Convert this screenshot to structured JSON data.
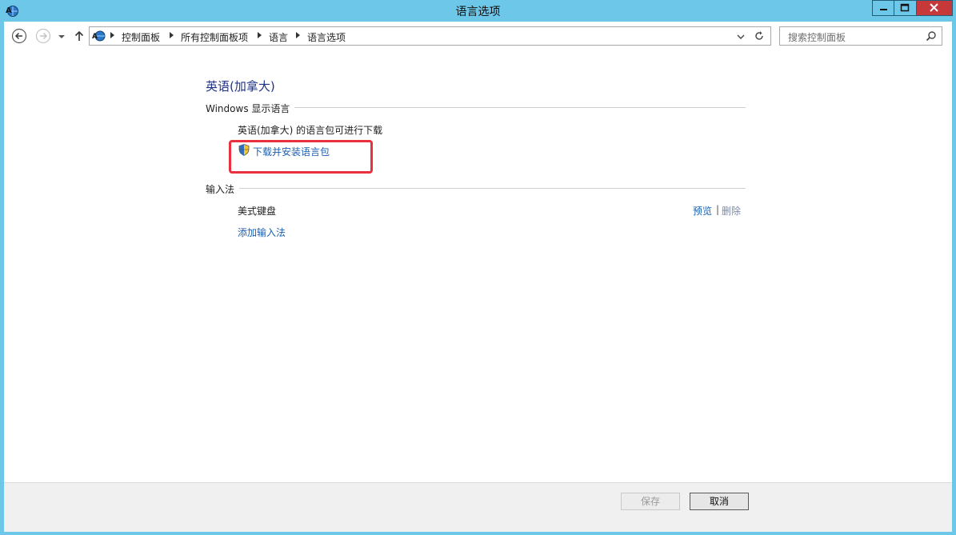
{
  "window": {
    "title": "语言选项",
    "app_icon": "globe-language-icon",
    "controls": [
      "minimize-icon",
      "maximize-icon",
      "close-icon"
    ]
  },
  "nav": {
    "back_icon": "back-arrow-icon",
    "forward_icon": "forward-arrow-icon",
    "recent_icon": "chevron-down-icon",
    "up_icon": "up-arrow-icon",
    "breadcrumb": [
      "控制面板",
      "所有控制面板项",
      "语言",
      "语言选项"
    ],
    "address_dropdown_icon": "chevron-down-icon",
    "refresh_icon": "refresh-icon",
    "search_placeholder": "搜索控制面板",
    "search_icon": "search-icon"
  },
  "main": {
    "language_title": "英语(加拿大)",
    "display_section": {
      "label": "Windows 显示语言",
      "status": "英语(加拿大) 的语言包可进行下载",
      "download_link": "下载并安装语言包",
      "shield_icon": "uac-shield-icon"
    },
    "input_section": {
      "label": "输入法",
      "method_name": "美式键盘",
      "preview_link": "预览",
      "divider": "|",
      "delete_link": "删除",
      "add_link": "添加输入法"
    }
  },
  "footer": {
    "save_label": "保存",
    "cancel_label": "取消"
  },
  "colors": {
    "titlebar": "#6cc7e8",
    "link": "#1b5fb0",
    "heading": "#1e3287",
    "highlight": "#e8303f",
    "close_button": "#c7383b"
  }
}
